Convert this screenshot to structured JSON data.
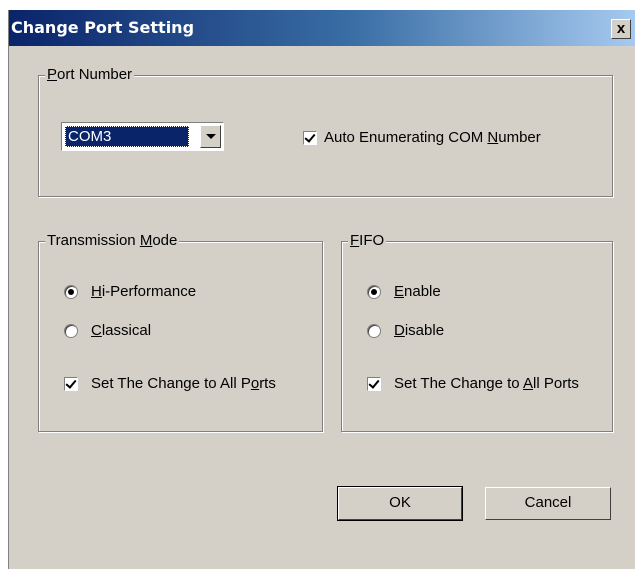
{
  "window": {
    "title": "Change Port Setting",
    "close_glyph": "x"
  },
  "port_number": {
    "legend_u": "P",
    "legend_rest": "ort Number",
    "selected_port": "COM3",
    "auto_enum_label_a": "Auto Enumerating COM ",
    "auto_enum_label_u": "N",
    "auto_enum_label_b": "umber",
    "auto_enum_checked": true
  },
  "transmission_mode": {
    "legend_a": "Transmission ",
    "legend_u": "M",
    "legend_b": "ode",
    "opt1_u": "H",
    "opt1_rest": "i-Performance",
    "opt2_u": "C",
    "opt2_rest": "lassical",
    "selected": "Hi-Performance",
    "apply_all_a": "Set The Change to All P",
    "apply_all_u": "o",
    "apply_all_b": "rts",
    "apply_all_checked": true
  },
  "fifo": {
    "legend_u": "F",
    "legend_rest": "IFO",
    "opt1_u": "E",
    "opt1_rest": "nable",
    "opt2_u": "D",
    "opt2_rest": "isable",
    "selected": "Enable",
    "apply_all_a": "Set The Change to ",
    "apply_all_u": "A",
    "apply_all_b": "ll Ports",
    "apply_all_checked": true
  },
  "buttons": {
    "ok": "OK",
    "cancel": "Cancel"
  },
  "colors": {
    "face": "#d4d0c8",
    "title_start": "#0a246a",
    "title_end": "#a6caf0",
    "selection": "#0a246a"
  }
}
